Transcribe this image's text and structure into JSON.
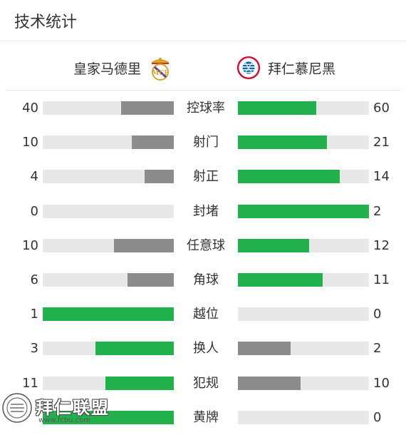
{
  "header": {
    "title": "技术统计"
  },
  "teams": {
    "home": {
      "name": "皇家马德里",
      "crest_icon": "real-madrid-crest"
    },
    "away": {
      "name": "拜仁慕尼黑",
      "crest_icon": "bayern-munich-crest",
      "crest_text": "FC BAYERN MÜNCHEN"
    }
  },
  "colors": {
    "green": "#22b14c",
    "gray": "#8c8c8c",
    "track": "#e8e8e8"
  },
  "stats": [
    {
      "label": "控球率",
      "home": "40",
      "away": "60",
      "home_share": 0.4,
      "away_share": 0.6,
      "leader": "away"
    },
    {
      "label": "射门",
      "home": "10",
      "away": "21",
      "home_share": 0.3226,
      "away_share": 0.6774,
      "leader": "away"
    },
    {
      "label": "射正",
      "home": "4",
      "away": "14",
      "home_share": 0.2222,
      "away_share": 0.7778,
      "leader": "away"
    },
    {
      "label": "封堵",
      "home": "0",
      "away": "2",
      "home_share": 0,
      "away_share": 1,
      "leader": "away"
    },
    {
      "label": "任意球",
      "home": "10",
      "away": "12",
      "home_share": 0.4545,
      "away_share": 0.5455,
      "leader": "away"
    },
    {
      "label": "角球",
      "home": "6",
      "away": "11",
      "home_share": 0.3529,
      "away_share": 0.6471,
      "leader": "away"
    },
    {
      "label": "越位",
      "home": "1",
      "away": "0",
      "home_share": 1,
      "away_share": 0,
      "leader": "home"
    },
    {
      "label": "换人",
      "home": "3",
      "away": "2",
      "home_share": 0.6,
      "away_share": 0.4,
      "leader": "home"
    },
    {
      "label": "犯规",
      "home": "11",
      "away": "10",
      "home_share": 0.5238,
      "away_share": 0.4762,
      "leader": "home"
    },
    {
      "label": "黄牌",
      "home": "",
      "away": "0",
      "home_share": 1,
      "away_share": 0,
      "leader": "home"
    }
  ],
  "watermark": {
    "text": "拜仁联盟",
    "url": "www.fcbu.com",
    "seal_text": "FC BAYERN"
  }
}
